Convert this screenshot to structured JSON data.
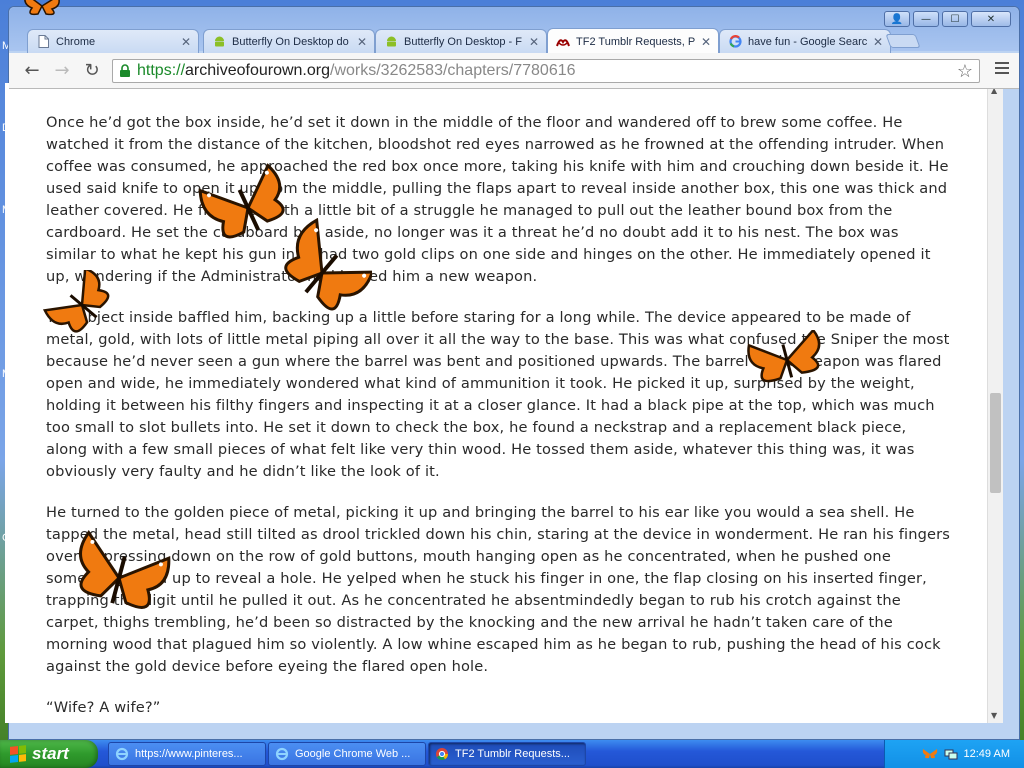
{
  "desktop": {
    "edge_letters": [
      "M",
      "D",
      "M",
      "M",
      "G"
    ]
  },
  "browser": {
    "tabs": [
      {
        "title": "Chrome",
        "icon": "page-icon"
      },
      {
        "title": "Butterfly On Desktop do",
        "icon": "android-icon"
      },
      {
        "title": "Butterfly On Desktop - F",
        "icon": "android-icon"
      },
      {
        "title": "TF2 Tumblr Requests, P",
        "icon": "ao3-icon",
        "active": true
      },
      {
        "title": "have fun - Google Searc",
        "icon": "google-icon"
      }
    ],
    "close_glyph": "✕",
    "window_buttons": {
      "user": "👤",
      "minimize": "—",
      "maximize": "☐",
      "close": "✕"
    },
    "nav": {
      "back": "←",
      "forward": "→",
      "reload": "↻"
    },
    "url": {
      "scheme": "https://",
      "host": "archiveofourown.org",
      "path": "/works/3262583/chapters/7780616"
    },
    "bookmark_star": "☆"
  },
  "article": {
    "top_cut_line": "***",
    "paragraphs": [
      "Once he’d got the box inside, he’d set it down in the middle of the floor and wandered off to brew some coffee. He watched it from the distance of the kitchen, bloodshot red eyes narrowed as he frowned at the offending intruder. When coffee was consumed, he approached the red box once more, taking his knife with him and crouching down beside it. He used said knife to open it up from the middle, pulling the flaps apart to reveal inside another box, this one was thick and leather covered. He frowned, with a little bit of a struggle he managed to pull out the leather bound box from the cardboard. He set the cardboard box aside, no longer was it a threat he’d no doubt add it to his nest. The box was similar to what he kept his gun in, it had two gold clips on one side and hinges on the other. He immediately opened it up, wondering if the Administrator had issued him a new weapon.",
      "The object inside baffled him, backing up a little before staring for a long while. The device appeared to be made of metal, gold, with lots of little metal piping all over it all the way to the base. This was what confused the Sniper the most because he’d never seen a gun where the barrel was bent and positioned upwards. The barrel of the weapon was flared open and wide, he immediately wondered what kind of ammunition it took. He picked it up, surprised by the weight, holding it between his filthy fingers and inspecting it at a closer glance. It had a black pipe at the top, which was much too small to slot bullets into. He set it down to check the box, he found a neckstrap and a replacement black piece, along with a few small pieces of what felt like very thin wood. He tossed them aside, whatever this thing was, it was obviously very faulty and he didn’t like the look of it.",
      "He turned to the golden piece of metal, picking it up and bringing the barrel to his ear like you would a sea shell. He tapped the metal, head still tilted as drool trickled down his chin, staring at the device in wonderment. He ran his fingers over it, pressing down on the row of gold buttons, mouth hanging open as he concentrated, when he pushed one something lifted up to reveal a hole. He yelped when he stuck his finger in one, the flap closing on his inserted finger, trapping the digit until he pulled it out. As he concentrated he absentmindedly began to rub his crotch against the carpet, thighs trembling, he’d been so distracted by the knocking and the new arrival he hadn’t taken care of the morning wood that plagued him so violently. A low whine escaped him as he began to rub, pushing the head of his cock against the gold device before eyeing the flared open hole.",
      "“Wife? A wife?”"
    ]
  },
  "butterflies": {
    "icon": "butterfly-icon",
    "count": 6
  },
  "taskbar": {
    "start_label": "start",
    "tasks": [
      {
        "title": "https://www.pinteres...",
        "icon": "ie-icon"
      },
      {
        "title": "Google Chrome Web ...",
        "icon": "ie-icon"
      },
      {
        "title": "TF2 Tumblr Requests...",
        "icon": "chrome-icon",
        "active": true
      }
    ],
    "clock": "12:49 AM"
  },
  "colors": {
    "url_scheme": "#1b8a2a",
    "taskbar": "#2458d8",
    "start_button": "#2f9a2c",
    "butterfly_orange": "#f07a10"
  }
}
